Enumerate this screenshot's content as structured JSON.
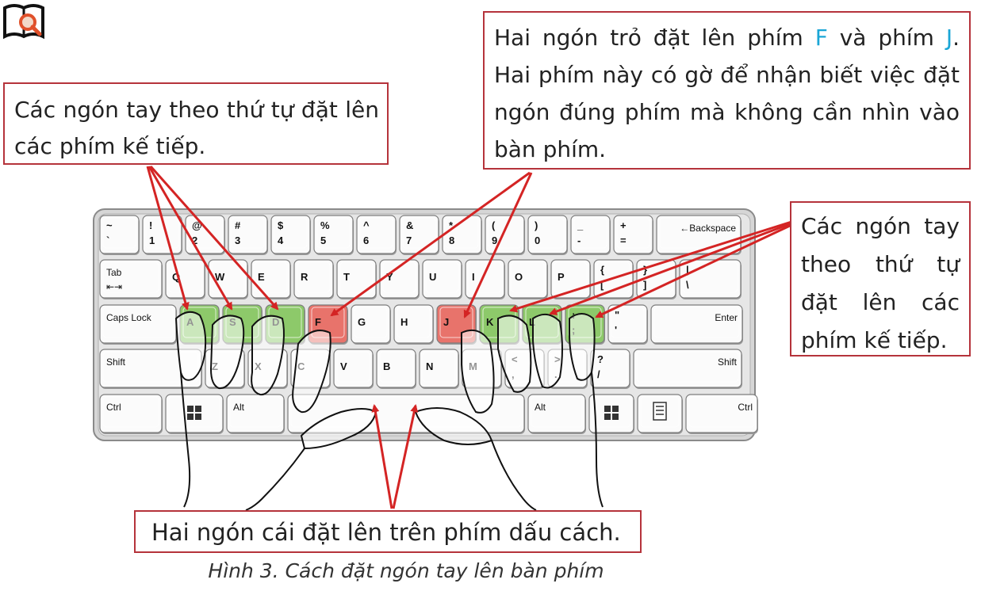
{
  "callouts": {
    "left": "Các ngón tay theo thứ tự đặt lên các phím kế tiếp.",
    "top_before_f": "Hai ngón trỏ đặt lên phím ",
    "top_f": "F",
    "top_mid": " và phím ",
    "top_j": "J",
    "top_after": ". Hai phím này có gờ để nhận biết việc đặt ngón đúng phím mà không cần nhìn vào bàn phím.",
    "right": "Các ngón tay theo thứ tự đặt lên các phím kế tiếp.",
    "bottom": "Hai ngón cái đặt lên trên phím dấu cách."
  },
  "caption": "Hình 3. Cách đặt ngón tay lên bàn phím",
  "colors": {
    "callout_border": "#b5333b",
    "arrow": "#d42424",
    "home_key_green": "#8dc96a",
    "index_key_red": "#e8736b",
    "highlight_text": "#1aa6d6"
  },
  "icons": {
    "corner": "book-search-icon"
  },
  "keyboard": {
    "rows": [
      [
        {
          "id": "backtick",
          "top": "~",
          "bottom": "`"
        },
        {
          "id": "1",
          "top": "!",
          "bottom": "1"
        },
        {
          "id": "2",
          "top": "@",
          "bottom": "2"
        },
        {
          "id": "3",
          "top": "#",
          "bottom": "3"
        },
        {
          "id": "4",
          "top": "$",
          "bottom": "4"
        },
        {
          "id": "5",
          "top": "%",
          "bottom": "5"
        },
        {
          "id": "6",
          "top": "^",
          "bottom": "6"
        },
        {
          "id": "7",
          "top": "&",
          "bottom": "7"
        },
        {
          "id": "8",
          "top": "*",
          "bottom": "8"
        },
        {
          "id": "9",
          "top": "(",
          "bottom": "9"
        },
        {
          "id": "0",
          "top": ")",
          "bottom": "0"
        },
        {
          "id": "minus",
          "top": "_",
          "bottom": "-"
        },
        {
          "id": "equals",
          "top": "+",
          "bottom": "="
        },
        {
          "id": "backspace",
          "label": "←Backspace"
        }
      ],
      [
        {
          "id": "tab",
          "label": "Tab",
          "sub": "⇤⇥"
        },
        {
          "id": "q",
          "label": "Q"
        },
        {
          "id": "w",
          "label": "W"
        },
        {
          "id": "e",
          "label": "E"
        },
        {
          "id": "r",
          "label": "R"
        },
        {
          "id": "t",
          "label": "T"
        },
        {
          "id": "y",
          "label": "Y"
        },
        {
          "id": "u",
          "label": "U"
        },
        {
          "id": "i",
          "label": "I"
        },
        {
          "id": "o",
          "label": "O"
        },
        {
          "id": "p",
          "label": "P"
        },
        {
          "id": "lbracket",
          "top": "{",
          "bottom": "["
        },
        {
          "id": "rbracket",
          "top": "}",
          "bottom": "]"
        },
        {
          "id": "backslash",
          "top": "|",
          "bottom": "\\"
        }
      ],
      [
        {
          "id": "capslock",
          "label": "Caps Lock"
        },
        {
          "id": "a",
          "label": "A",
          "state": "home"
        },
        {
          "id": "s",
          "label": "S",
          "state": "home"
        },
        {
          "id": "d",
          "label": "D",
          "state": "home"
        },
        {
          "id": "f",
          "label": "F",
          "state": "index"
        },
        {
          "id": "g",
          "label": "G"
        },
        {
          "id": "h",
          "label": "H"
        },
        {
          "id": "j",
          "label": "J",
          "state": "index"
        },
        {
          "id": "k",
          "label": "K",
          "state": "home"
        },
        {
          "id": "l",
          "label": "L",
          "state": "home"
        },
        {
          "id": "semicolon",
          "top": ":",
          "bottom": ";",
          "state": "home"
        },
        {
          "id": "quote",
          "top": "\"",
          "bottom": "'"
        },
        {
          "id": "enter",
          "label": "Enter"
        }
      ],
      [
        {
          "id": "lshift",
          "label": "Shift"
        },
        {
          "id": "z",
          "label": "Z"
        },
        {
          "id": "x",
          "label": "X"
        },
        {
          "id": "c",
          "label": "C"
        },
        {
          "id": "v",
          "label": "V"
        },
        {
          "id": "b",
          "label": "B"
        },
        {
          "id": "n",
          "label": "N"
        },
        {
          "id": "m",
          "label": "M"
        },
        {
          "id": "comma",
          "top": "<",
          "bottom": ","
        },
        {
          "id": "period",
          "top": ">",
          "bottom": "."
        },
        {
          "id": "slash",
          "top": "?",
          "bottom": "/"
        },
        {
          "id": "rshift",
          "label": "Shift"
        }
      ],
      [
        {
          "id": "lctrl",
          "label": "Ctrl"
        },
        {
          "id": "lwin",
          "label": "",
          "icon": "windows-icon"
        },
        {
          "id": "lalt",
          "label": "Alt"
        },
        {
          "id": "space",
          "label": ""
        },
        {
          "id": "ralt",
          "label": "Alt"
        },
        {
          "id": "rwin",
          "label": "",
          "icon": "windows-icon"
        },
        {
          "id": "menu",
          "label": "",
          "icon": "menu-icon"
        },
        {
          "id": "rctrl",
          "label": "Ctrl"
        }
      ]
    ]
  }
}
